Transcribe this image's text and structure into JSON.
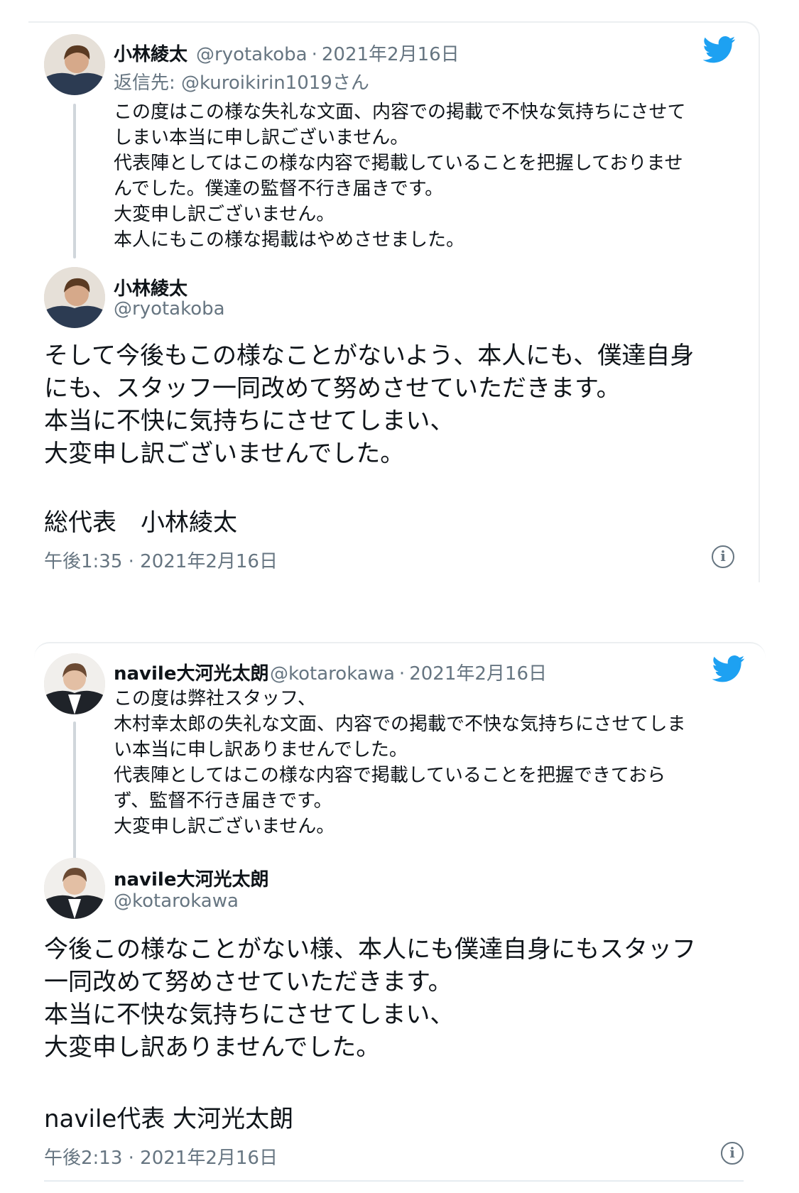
{
  "accent_color": "#1da1f2",
  "tweets": [
    {
      "reply": {
        "name": "小林綾太",
        "handle": "@ryotakoba",
        "date": "2021年2月16日",
        "reply_to": "返信先: @kuroikirin1019さん",
        "text": "この度はこの様な失礼な文面、内容での掲載で不快な気持ちにさせて\nしまい本当に申し訳ございません。\n代表陣としてはこの様な内容で掲載していることを把握しておりませ\nんでした。僕達の監督不行き届きです。\n大変申し訳ございません。\n本人にもこの様な掲載はやめさせました。"
      },
      "main": {
        "name": "小林綾太",
        "handle": "@ryotakoba",
        "text": "そして今後もこの様なことがないよう、本人にも、僕達自身\nにも、スタッフ一同改めて努めさせていただきます。\n本当に不快に気持ちにさせてしまい、\n大変申し訳ございませんでした。",
        "signature": "総代表　小林綾太",
        "timestamp": "午後1:35 · 2021年2月16日"
      },
      "icons": {
        "brand": "twitter-bird-icon",
        "info": "info-icon"
      }
    },
    {
      "reply": {
        "name": "navile大河光太朗",
        "handle": "@kotarokawa",
        "date": "2021年2月16日",
        "text": "この度は弊社スタッフ、\n木村幸太郎の失礼な文面、内容での掲載で不快な気持ちにさせてしま\nい本当に申し訳ありませんでした。\n代表陣としてはこの様な内容で掲載していることを把握できておら\nず、監督不行き届きです。\n大変申し訳ございません。"
      },
      "main": {
        "name": "navile大河光太朗",
        "handle": "@kotarokawa",
        "text": "今後この様なことがない様、本人にも僕達自身にもスタッフ\n一同改めて努めさせていただきます。\n本当に不快な気持ちにさせてしまい、\n大変申し訳ありませんでした。",
        "signature": "navile代表 大河光太朗",
        "timestamp": "午後2:13 · 2021年2月16日"
      },
      "icons": {
        "brand": "twitter-bird-icon",
        "info": "info-icon"
      }
    }
  ]
}
